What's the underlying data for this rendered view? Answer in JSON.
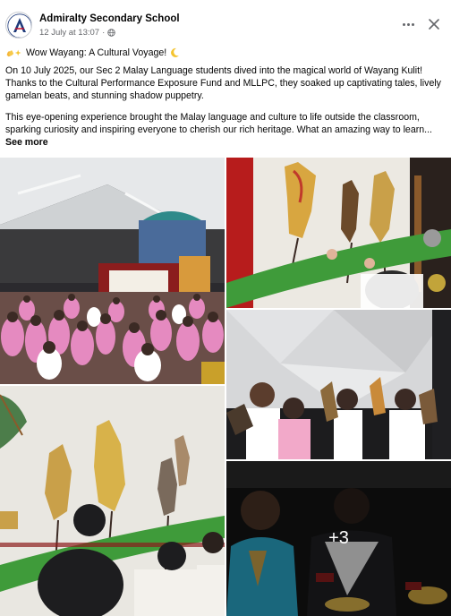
{
  "post": {
    "page_name": "Admiralty Secondary School",
    "date": "12 July at 13:07",
    "separator": "·",
    "title_line": "Wow Wayang: A Cultural Voyage!",
    "paragraph1": "On 10 July 2025, our Sec 2 Malay Language students dived into the magical world of Wayang Kulit! Thanks to the Cultural Performance Exposure Fund and MLLPC, they soaked up captivating tales, lively gamelan beats, and stunning shadow puppetry.",
    "paragraph2": "This eye-opening experience brought the Malay language and culture to life outside the classroom, sparking curiosity and inspiring everyone to cherish our rich heritage. What an amazing way to learn...",
    "see_more": "See more"
  },
  "photos": {
    "more_count": "+3",
    "icons": {
      "privacy": "globe-icon",
      "menu": "more-horizontal-icon",
      "close": "close-icon",
      "lead_emoji": "clapping-sparkles-emoji",
      "trail_emoji": "crescent-moon-emoji"
    }
  },
  "colors": {
    "secondary_text": "#65676b",
    "overlay": "rgba(0,0,0,0.38)",
    "uniform_pink": "#e58ac0",
    "banana_stem": "#3f9b3a"
  }
}
